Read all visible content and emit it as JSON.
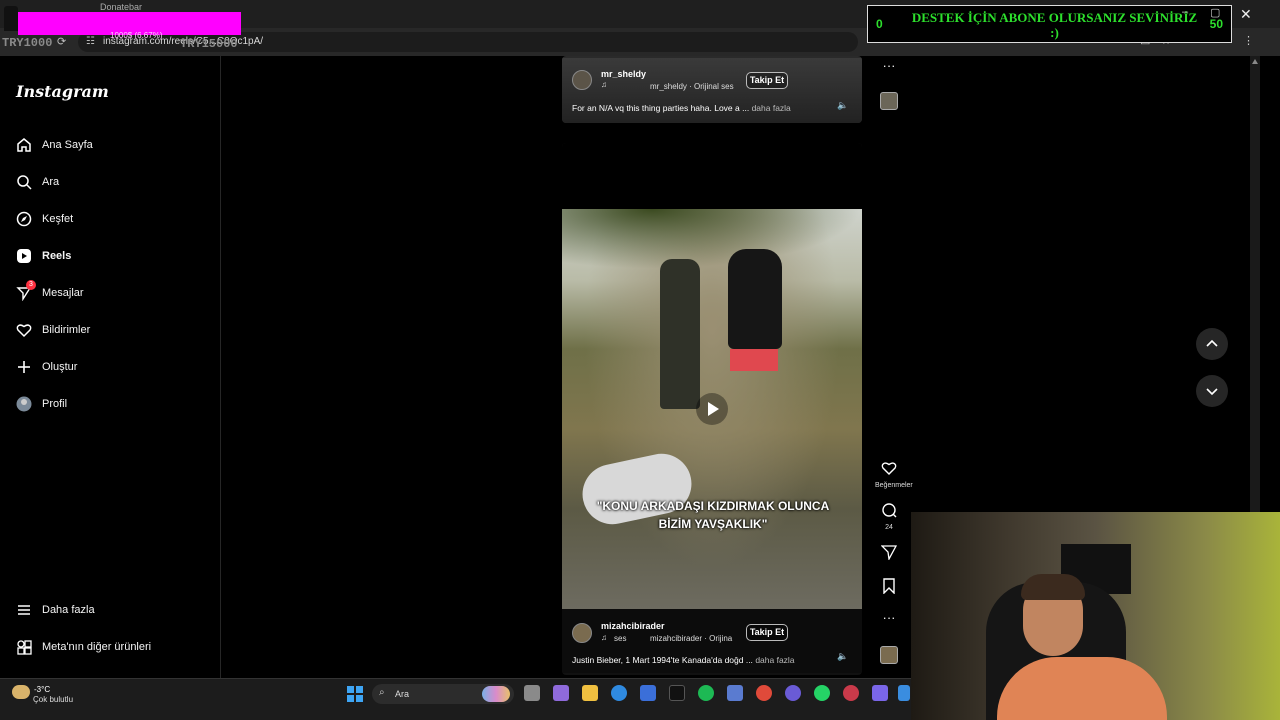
{
  "browser": {
    "url": "instagram.com/reels/C5...C0Oc1pA/",
    "overlay_left": "TRY1000",
    "overlay_mid": "TRY15000",
    "donate_title": "Donatebar",
    "donate_progress": "1000$ (6.67%)"
  },
  "goal": {
    "text": "DESTEK İÇİN ABONE OLURSANIZ SEVİNİRİZ :)",
    "min": "0",
    "max": "50"
  },
  "sidebar": {
    "logo": "Instagram",
    "items": [
      {
        "label": "Ana Sayfa"
      },
      {
        "label": "Ara"
      },
      {
        "label": "Keşfet"
      },
      {
        "label": "Reels"
      },
      {
        "label": "Mesajlar",
        "badge": "3"
      },
      {
        "label": "Bildirimler"
      },
      {
        "label": "Oluştur"
      },
      {
        "label": "Profil"
      }
    ],
    "more": "Daha fazla",
    "meta": "Meta'nın diğer ürünleri"
  },
  "posts": [
    {
      "user": "mr_sheldy",
      "audio": "mr_sheldy · Orijinal ses",
      "follow": "Takip Et",
      "desc": "For an N/A vq this thing parties haha. Love a ...",
      "more": "daha fazla"
    },
    {
      "user": "mizahcibirader",
      "music": "ses",
      "audio": "mizahcibirader · Orijina",
      "follow": "Takip Et",
      "desc": "Justin Bieber, 1 Mart 1994'te Kanada'da doğd ...",
      "more": "daha fazla",
      "caption": "\"KONU ARKADAŞI KIZDIRMAK OLUNCA BİZİM YAVŞAKLIK\"",
      "likes_label": "Beğenmeler",
      "comments": "24"
    }
  ],
  "taskbar": {
    "temp": "-3°C",
    "weather": "Çok bulutlu",
    "search": "Ara"
  },
  "colors": {
    "goal_green": "#2de02d",
    "donate_magenta": "#ff00ff",
    "badge_red": "#ff3040"
  }
}
